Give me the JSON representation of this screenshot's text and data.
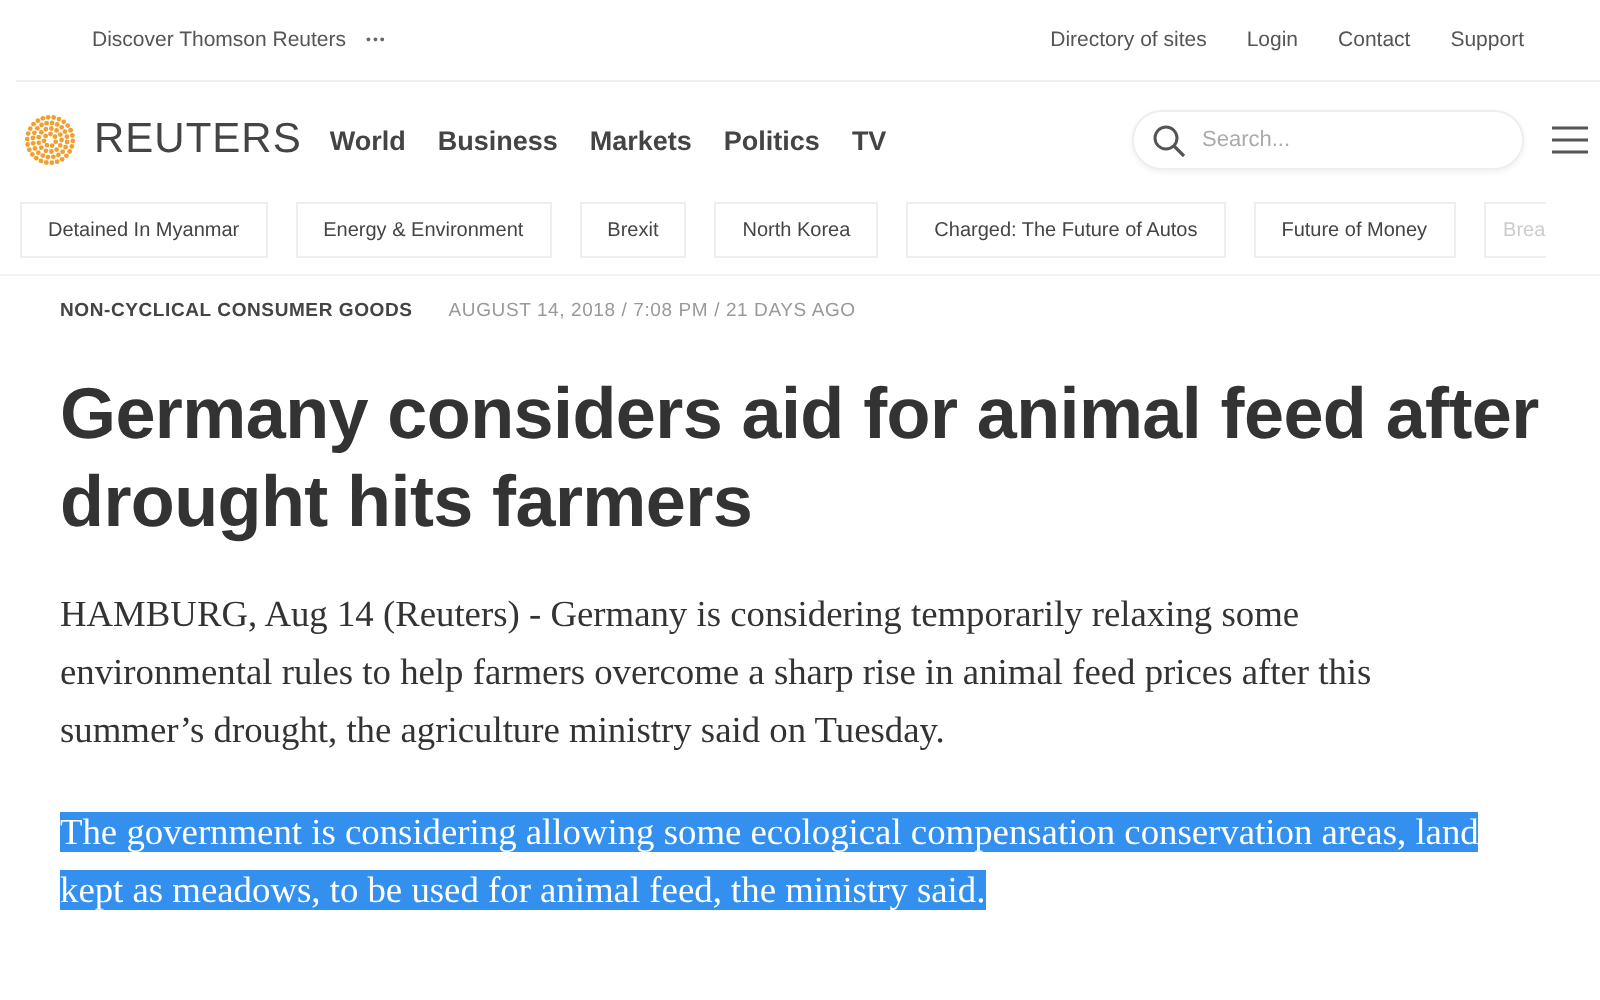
{
  "top_bar": {
    "left_link": "Discover Thomson Reuters",
    "more_icon": "•••",
    "links": [
      "Directory of sites",
      "Login",
      "Contact",
      "Support"
    ]
  },
  "header": {
    "logo_text": "REUTERS",
    "nav": [
      "World",
      "Business",
      "Markets",
      "Politics",
      "TV"
    ],
    "search": {
      "placeholder": "Search..."
    }
  },
  "topics": [
    {
      "label": "Detained In Myanmar"
    },
    {
      "label": "Energy & Environment"
    },
    {
      "label": "Brexit"
    },
    {
      "label": "North Korea"
    },
    {
      "label": "Charged: The Future of Autos"
    },
    {
      "label": "Future of Money"
    },
    {
      "label": "Brea"
    }
  ],
  "article": {
    "category": "NON-CYCLICAL CONSUMER GOODS",
    "dateline": "AUGUST 14, 2018 / 7:08 PM / 21 DAYS AGO",
    "headline": "Germany considers aid for animal feed after drought hits farmers",
    "paragraphs": [
      {
        "text": "HAMBURG, Aug 14 (Reuters) - Germany is considering temporarily relaxing some environmental rules to help farmers overcome a sharp rise in animal feed prices after this summer’s drought, the agriculture ministry said on Tuesday.",
        "selected": false
      },
      {
        "text": "The government is considering allowing some ecological compensation conservation areas, land kept as meadows, to be used for animal feed, the ministry said.",
        "selected": true
      }
    ]
  }
}
